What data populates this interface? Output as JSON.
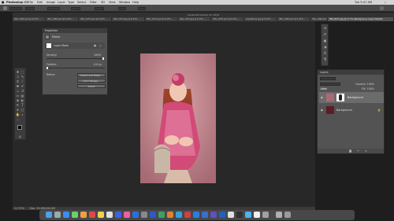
{
  "menubar": {
    "items": [
      "Photoshop CC",
      "File",
      "Edit",
      "Image",
      "Layer",
      "Type",
      "Select",
      "Filter",
      "3D",
      "View",
      "Window",
      "Help"
    ],
    "clock": "Tue 9:47 AM"
  },
  "window_title": "Adobe Photoshop CC 2016",
  "tabs": [
    {
      "label": "IMG_1999.psd @ 6.25% ..."
    },
    {
      "label": "IMG_1998.psd @ 6.25% ..."
    },
    {
      "label": "IMG_1973.psd @ 6.25% ..."
    },
    {
      "label": "IMG_1971.jpg @ 6.25% ..."
    },
    {
      "label": "IMG_1974.psd @ 6.25% ..."
    },
    {
      "label": "IMG_1974.jpg @ 6.25% ..."
    },
    {
      "label": "IMG_1976.psd @ 6.25% ..."
    },
    {
      "label": "sepiablend.jpg @ 6.25% ..."
    },
    {
      "label": "IMG_1998.psd @ 6.25% ..."
    },
    {
      "label": "IMG_1998.psd @ 6.25% ..."
    }
  ],
  "active_tab": "IMG_8157.jpg @ 11.7% (Background, Layer Mask/8)",
  "properties_panel": {
    "header": "Properties",
    "section": "Masks",
    "row_label": "Layer Mask",
    "density_label": "Density:",
    "density_value": "100%",
    "feather_label": "Feather:",
    "feather_value": "0.0 px",
    "refine_label": "Refine:",
    "buttons": [
      "Select and Mask...",
      "Color Range...",
      "Invert"
    ]
  },
  "layers_panel": {
    "header": "Layers",
    "kind_label": "Kind",
    "mode_label": "Normal",
    "opacity_label": "Opacity: 100%",
    "fill_label": "Fill: 100%",
    "lock_label": "Lock:",
    "layers": [
      {
        "name": "Background"
      },
      {
        "name": "Background"
      }
    ]
  },
  "status": {
    "zoom": "11.72%",
    "doc": "Doc: 52.0M/104.0M"
  },
  "colors": {
    "panel_bg": "#535353",
    "app_bg": "#1e1e1e",
    "accent": "#2d7be5"
  }
}
